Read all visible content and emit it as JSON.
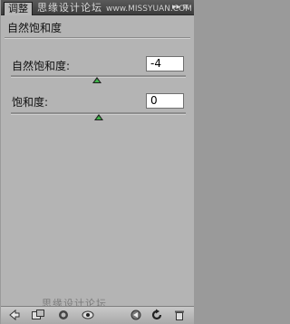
{
  "titlebar": {
    "tab_label": "调整",
    "watermark": "思缘设计论坛",
    "watermark_url": "www.MISSYUAN.COM",
    "collapse_glyph": "▸▸",
    "menu_glyph": "≡"
  },
  "panel": {
    "title": "自然饱和度"
  },
  "vibrance": {
    "label": "自然饱和度:",
    "value": "-4",
    "slider_fraction": 0.49
  },
  "saturation": {
    "label": "饱和度:",
    "value": "0",
    "slider_fraction": 0.5
  },
  "footer": {
    "watermark": "思缘设计论坛"
  },
  "toolbar": {
    "icons": [
      "back-arrow-icon",
      "expand-view-icon",
      "clip-layer-icon",
      "visibility-eye-icon",
      "view-previous-icon",
      "reset-icon",
      "delete-trash-icon"
    ]
  },
  "colors": {
    "panel_bg": "#b4b4b4",
    "titlebar": "#3c3c3c",
    "slider_thumb_accent": "#3fb54a"
  }
}
